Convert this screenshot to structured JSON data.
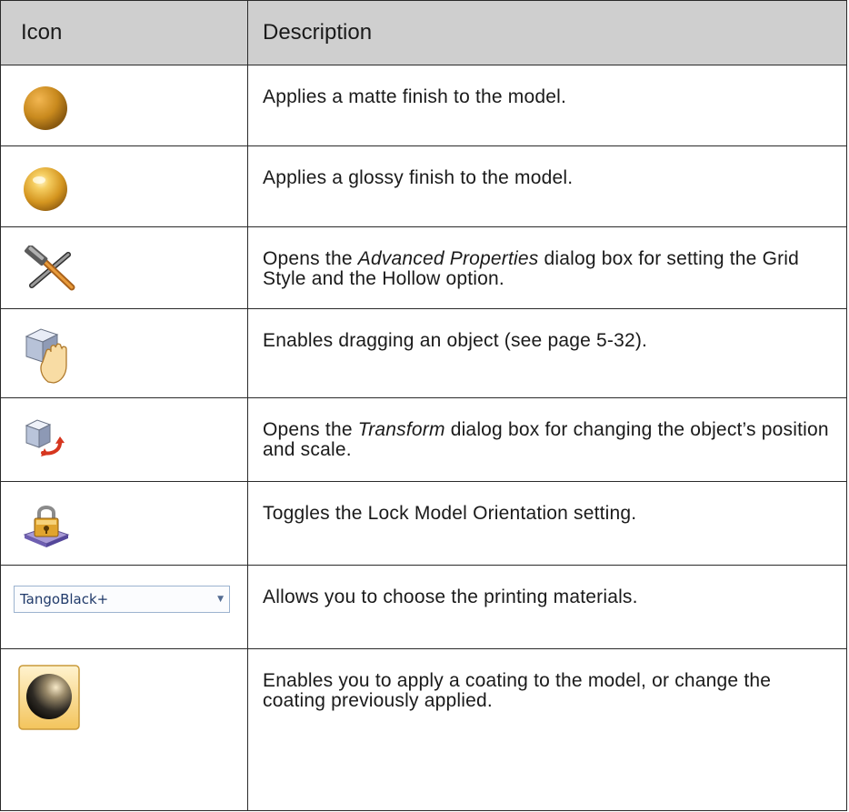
{
  "header": {
    "icon_col": "Icon",
    "desc_col": "Description"
  },
  "rows": [
    {
      "icon": "matte-sphere-icon",
      "desc": "Applies a matte finish to the model."
    },
    {
      "icon": "glossy-sphere-icon",
      "desc": "Applies a glossy finish to the model."
    },
    {
      "icon": "tools-icon",
      "desc_pre": "Opens the ",
      "desc_em": "Advanced Properties",
      "desc_post": " dialog box for setting the Grid Style and the Hollow option."
    },
    {
      "icon": "drag-object-icon",
      "desc": "Enables dragging an object (see page 5-32)."
    },
    {
      "icon": "transform-icon",
      "desc_pre": "Opens the ",
      "desc_em": "Transform",
      "desc_post": " dialog box for changing the object’s position and scale."
    },
    {
      "icon": "lock-orientation-icon",
      "desc": "Toggles the Lock Model Orientation setting."
    },
    {
      "icon": "materials-dropdown",
      "dropdown_value": "TangoBlack+",
      "desc": "Allows you to choose the printing materials."
    },
    {
      "icon": "coating-icon",
      "desc": "Enables you to apply a coating to the model, or change the coating previously applied."
    }
  ]
}
